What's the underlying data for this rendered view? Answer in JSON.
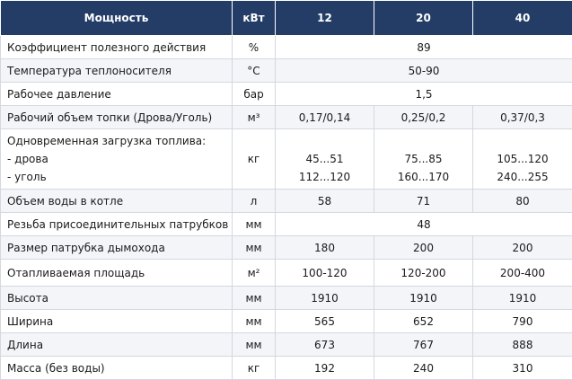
{
  "header": {
    "col_name": "Мощность",
    "col_unit": "кВт",
    "models": [
      "12",
      "20",
      "40"
    ]
  },
  "rows": [
    {
      "name": "Коэффициент полезного действия",
      "unit": "%",
      "merged": "89"
    },
    {
      "name": "Температура теплоносителя",
      "unit": "°С",
      "merged": "50-90"
    },
    {
      "name": "Рабочее давление",
      "unit": "бар",
      "merged": "1,5"
    },
    {
      "name": "Рабочий объем топки (Дрова/Уголь)",
      "unit": "м³",
      "values": [
        "0,17/0,14",
        "0,25/0,2",
        "0,37/0,3"
      ]
    },
    {
      "name_lines": [
        "Одновременная загрузка топлива:",
        "- дрова",
        "- уголь"
      ],
      "unit": "кг",
      "values_wood": [
        "45...51",
        "75...85",
        "105...120"
      ],
      "values_coal": [
        "112...120",
        "160...170",
        "240...255"
      ]
    },
    {
      "name": "Объем воды в котле",
      "unit": "л",
      "values": [
        "58",
        "71",
        "80"
      ]
    },
    {
      "name": "Резьба присоединительных патрубков",
      "unit": "мм",
      "merged": "48"
    },
    {
      "name": "Размер патрубка дымохода",
      "unit": "мм",
      "values": [
        "180",
        "200",
        "200"
      ]
    },
    {
      "name": "Отапливаемая площадь",
      "unit": "м²",
      "values": [
        "100-120",
        "120-200",
        "200-400"
      ]
    },
    {
      "name": "Высота",
      "unit": "мм",
      "values": [
        "1910",
        "1910",
        "1910"
      ]
    },
    {
      "name": "Ширина",
      "unit": "мм",
      "values": [
        "565",
        "652",
        "790"
      ]
    },
    {
      "name": "Длина",
      "unit": "мм",
      "values": [
        "673",
        "767",
        "888"
      ]
    },
    {
      "name": "Масса (без воды)",
      "unit": "кг",
      "values": [
        "192",
        "240",
        "310"
      ]
    }
  ]
}
